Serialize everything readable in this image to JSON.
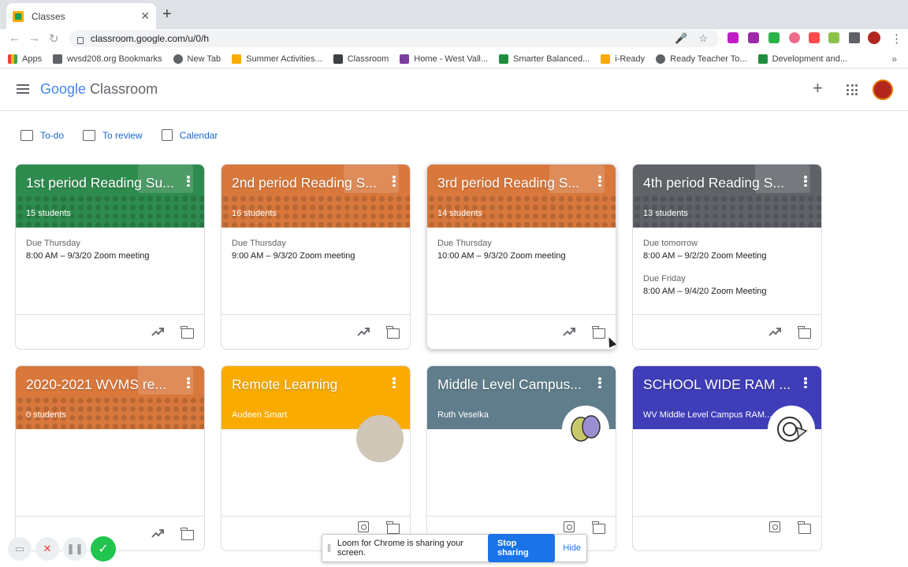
{
  "browser": {
    "tab_title": "Classes",
    "url": "classroom.google.com/u/0/h",
    "bookmarks": [
      "Apps",
      "wvsd208.org Bookmarks",
      "New Tab",
      "Summer Activities...",
      "Classroom",
      "Home - West Vall...",
      "Smarter Balanced...",
      "i-Ready",
      "Ready Teacher To...",
      "Development and..."
    ]
  },
  "header": {
    "logo_google": "Google",
    "logo_product": "Classroom"
  },
  "subnav": {
    "todo": "To-do",
    "review": "To review",
    "calendar": "Calendar"
  },
  "colors": {
    "green": "#2e8b4e",
    "orange": "#d9783c",
    "gray": "#5f6368",
    "amber": "#f9ab00",
    "slate": "#607d8b",
    "indigo": "#3f3db8",
    "link": "#1967d2",
    "stop_btn": "#1a73e8",
    "done_btn": "#21c44e"
  },
  "cards": [
    {
      "title": "1st period Reading Su...",
      "sub": "15 students",
      "items": [
        {
          "due": "Due Thursday",
          "what": "8:00 AM – 9/3/20 Zoom meeting"
        }
      ],
      "footer": [
        "trend-icon",
        "folder-icon"
      ]
    },
    {
      "title": "2nd period Reading S...",
      "sub": "16 students",
      "items": [
        {
          "due": "Due Thursday",
          "what": "9:00 AM – 9/3/20 Zoom meeting"
        }
      ],
      "footer": [
        "trend-icon",
        "folder-icon"
      ]
    },
    {
      "title": "3rd period Reading S...",
      "sub": "14 students",
      "items": [
        {
          "due": "Due Thursday",
          "what": "10:00 AM – 9/3/20 Zoom meeting"
        }
      ],
      "footer": [
        "trend-icon",
        "folder-icon"
      ]
    },
    {
      "title": "4th period Reading S...",
      "sub": "13 students",
      "items": [
        {
          "due": "Due tomorrow",
          "what": "8:00 AM – 9/2/20 Zoom Meeting"
        },
        {
          "due": "Due Friday",
          "what": "8:00 AM – 9/4/20 Zoom Meeting"
        }
      ],
      "footer": [
        "trend-icon",
        "folder-icon"
      ]
    },
    {
      "title": "2020-2021 WVMS re...",
      "sub": "0 students",
      "items": [],
      "footer": [
        "trend-icon",
        "folder-icon"
      ]
    },
    {
      "title": "Remote Learning",
      "sub": "Audeen Smart",
      "items": [],
      "footer": [
        "camera-icon",
        "folder-icon"
      ]
    },
    {
      "title": "Middle Level Campus...",
      "sub": "Ruth Veselka",
      "items": [],
      "footer": [
        "camera-icon",
        "folder-icon"
      ]
    },
    {
      "title": "SCHOOL WIDE RAM ...",
      "sub": "WV Middle Level Campus RAM...",
      "items": [],
      "footer": [
        "camera-icon",
        "folder-icon"
      ]
    }
  ],
  "loom": {
    "message": "Loom for Chrome is sharing your screen.",
    "stop": "Stop sharing",
    "hide": "Hide"
  }
}
